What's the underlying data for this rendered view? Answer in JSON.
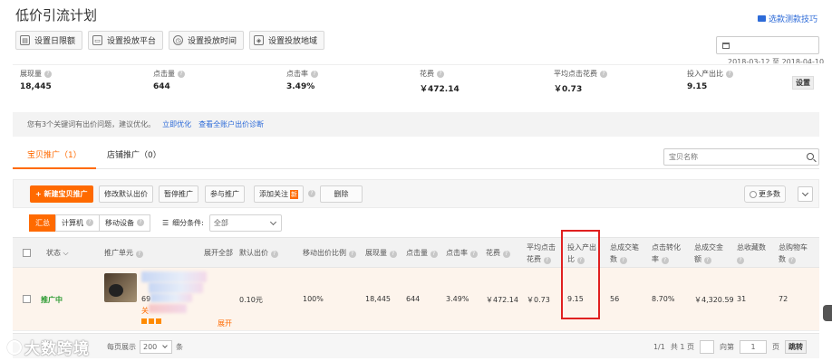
{
  "page": {
    "title": "低价引流计划",
    "help_link": "选款测款技巧"
  },
  "toolbar": [
    {
      "label": "设置日限额",
      "icon": "calendar-limit-icon"
    },
    {
      "label": "设置投放平台",
      "icon": "monitor-icon"
    },
    {
      "label": "设置投放时间",
      "icon": "clock-icon"
    },
    {
      "label": "设置投放地域",
      "icon": "map-icon"
    }
  ],
  "date": {
    "range": "2018-03-12 至 2018-04-10"
  },
  "stats": [
    {
      "label": "展现量",
      "value": "18,445"
    },
    {
      "label": "点击量",
      "value": "644"
    },
    {
      "label": "点击率",
      "value": "3.49%"
    },
    {
      "label": "花费",
      "value": "￥472.14"
    },
    {
      "label": "平均点击花费",
      "value": "￥0.73"
    },
    {
      "label": "投入产出比",
      "value": "9.15"
    }
  ],
  "stats_settings": "设置",
  "notice": {
    "text": "您有3个关键词有出价问题，建议优化。",
    "link1": "立即优化",
    "link2": "查看全账户出价诊断"
  },
  "tabs": [
    {
      "label": "宝贝推广（1）",
      "active": true
    },
    {
      "label": "店铺推广（0）",
      "active": false
    }
  ],
  "search": {
    "placeholder": "宝贝名称"
  },
  "actions": {
    "new": "+ 新建宝贝推广",
    "modify_bid": "修改默认出价",
    "pause": "暂停推广",
    "join": "参与推广",
    "follow": "添加关注",
    "follow_badge": "新",
    "delete": "删除",
    "more": "更多数"
  },
  "filters": {
    "all": "汇总",
    "pc": "计算机",
    "mobile": "移动设备",
    "segment_label": "细分条件:",
    "segment_value": "全部"
  },
  "table": {
    "headers": {
      "status": "状态",
      "unit": "推广单元",
      "expand_all": "展开全部",
      "default_bid": "默认出价",
      "mobile_ratio": "移动出价比例",
      "impressions": "展现量",
      "clicks": "点击量",
      "ctr": "点击率",
      "cost": "花费",
      "avg_cpc_1": "平均点击",
      "avg_cpc_2": "花费",
      "roi_1": "投入产出",
      "roi_2": "比",
      "deals_1": "总成交笔",
      "deals_2": "数",
      "cvr_1": "点击转化",
      "cvr_2": "率",
      "gmv_1": "总成交金",
      "gmv_2": "额",
      "favorites": "总收藏数",
      "cart_1": "总购物车",
      "cart_2": "数"
    },
    "row": {
      "status": "推广中",
      "unit_prefix": "69",
      "unit_tag": "关",
      "expand": "展开",
      "default_bid": "0.10元",
      "mobile_ratio": "100%",
      "impressions": "18,445",
      "clicks": "644",
      "ctr": "3.49%",
      "cost": "￥472.14",
      "avg_cpc": "￥0.73",
      "roi": "9.15",
      "deals": "56",
      "cvr": "8.70%",
      "gmv": "￥4,320.59",
      "favorites": "31",
      "cart": "72"
    }
  },
  "pager": {
    "per_page_label": "每页展示",
    "per_page": "200",
    "unit": "条",
    "position": "1/1",
    "total": "共 1 页",
    "goto": "向第",
    "page": "1",
    "page_unit": "页",
    "jump": "跳转"
  },
  "watermark": "大数跨境"
}
